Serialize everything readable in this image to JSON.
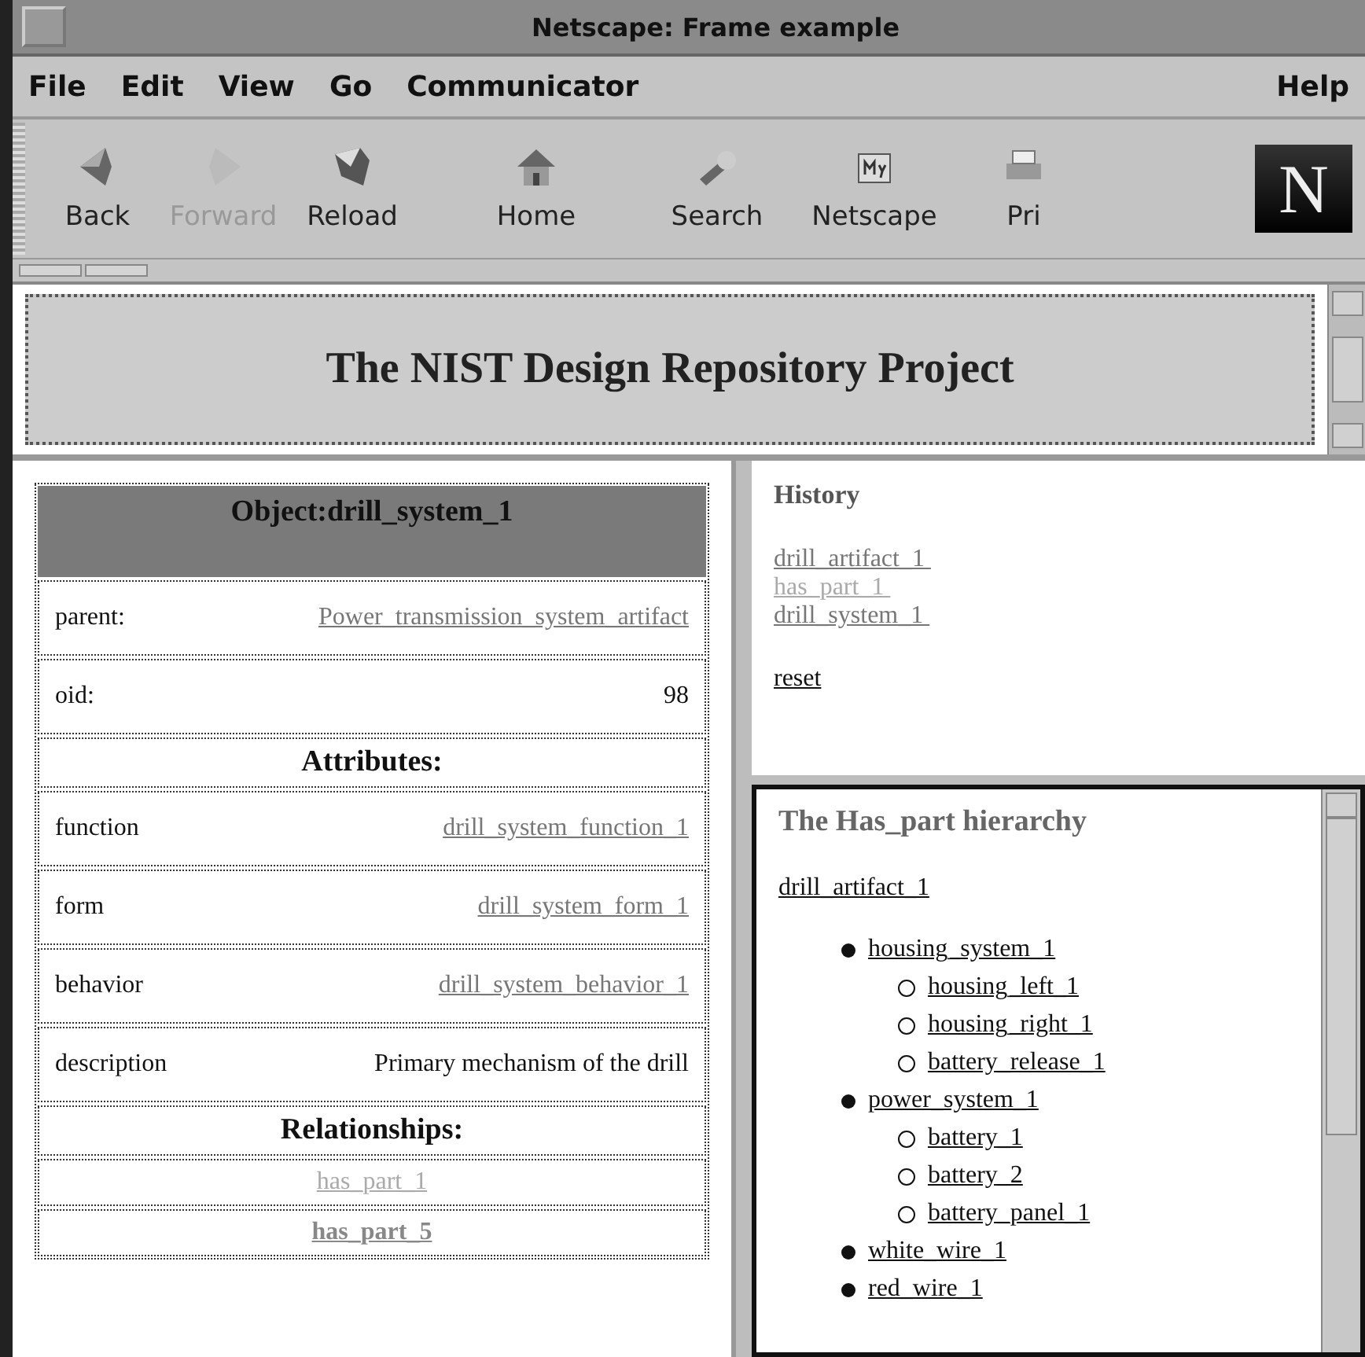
{
  "window": {
    "title": "Netscape: Frame example",
    "menu_left": [
      "File",
      "Edit",
      "View",
      "Go",
      "Communicator"
    ],
    "menu_right": "Help"
  },
  "toolbar": {
    "buttons": [
      {
        "kind": "back",
        "label": "Back",
        "disabled": false
      },
      {
        "kind": "forward",
        "label": "Forward",
        "disabled": true
      },
      {
        "kind": "reload",
        "label": "Reload",
        "disabled": false
      },
      {
        "kind": "home",
        "label": "Home",
        "disabled": false
      },
      {
        "kind": "search",
        "label": "Search",
        "disabled": false
      },
      {
        "kind": "netscape",
        "label": "Netscape",
        "disabled": false
      },
      {
        "kind": "print",
        "label": "Pri",
        "disabled": false
      }
    ],
    "logo": "N"
  },
  "banner": {
    "title": "The NIST Design Repository Project"
  },
  "object": {
    "title": "Object:drill_system_1",
    "parent": {
      "label": "parent:",
      "link": "Power_transmission_system_artifact",
      "visited": true
    },
    "oid": {
      "label": "oid:",
      "value": "98"
    },
    "attributes_heading": "Attributes:",
    "attributes": [
      {
        "name": "function",
        "value": "drill_system_function_1",
        "kind": "link",
        "visited": true
      },
      {
        "name": "form",
        "value": "drill_system_form_1",
        "kind": "link",
        "visited": true
      },
      {
        "name": "behavior",
        "value": "drill_system_behavior_1",
        "kind": "link",
        "visited": true
      },
      {
        "name": "description",
        "value": "Primary mechanism of the drill",
        "kind": "text",
        "visited": false
      }
    ],
    "relationships_heading": "Relationships:",
    "relationships": [
      {
        "label": "has_part_1",
        "selected": false
      },
      {
        "label": "has_part_5",
        "selected": true
      }
    ]
  },
  "history": {
    "title": "History",
    "links": [
      {
        "label": "drill_artifact_1 ",
        "selected": false
      },
      {
        "label": "has_part_1 ",
        "selected": true
      },
      {
        "label": "drill_system_1 ",
        "selected": false
      }
    ],
    "reset": "reset"
  },
  "hierarchy": {
    "title": "The Has_part hierarchy",
    "root": "drill_artifact_1",
    "children": [
      {
        "label": "housing_system_1",
        "children": [
          {
            "label": "housing_left_1"
          },
          {
            "label": "housing_right_1"
          },
          {
            "label": "battery_release_1"
          }
        ]
      },
      {
        "label": "power_system_1",
        "children": [
          {
            "label": "battery_1"
          },
          {
            "label": "battery_2"
          },
          {
            "label": "battery_panel_1"
          }
        ]
      },
      {
        "label": "white_wire_1"
      },
      {
        "label": "red_wire_1"
      }
    ]
  }
}
